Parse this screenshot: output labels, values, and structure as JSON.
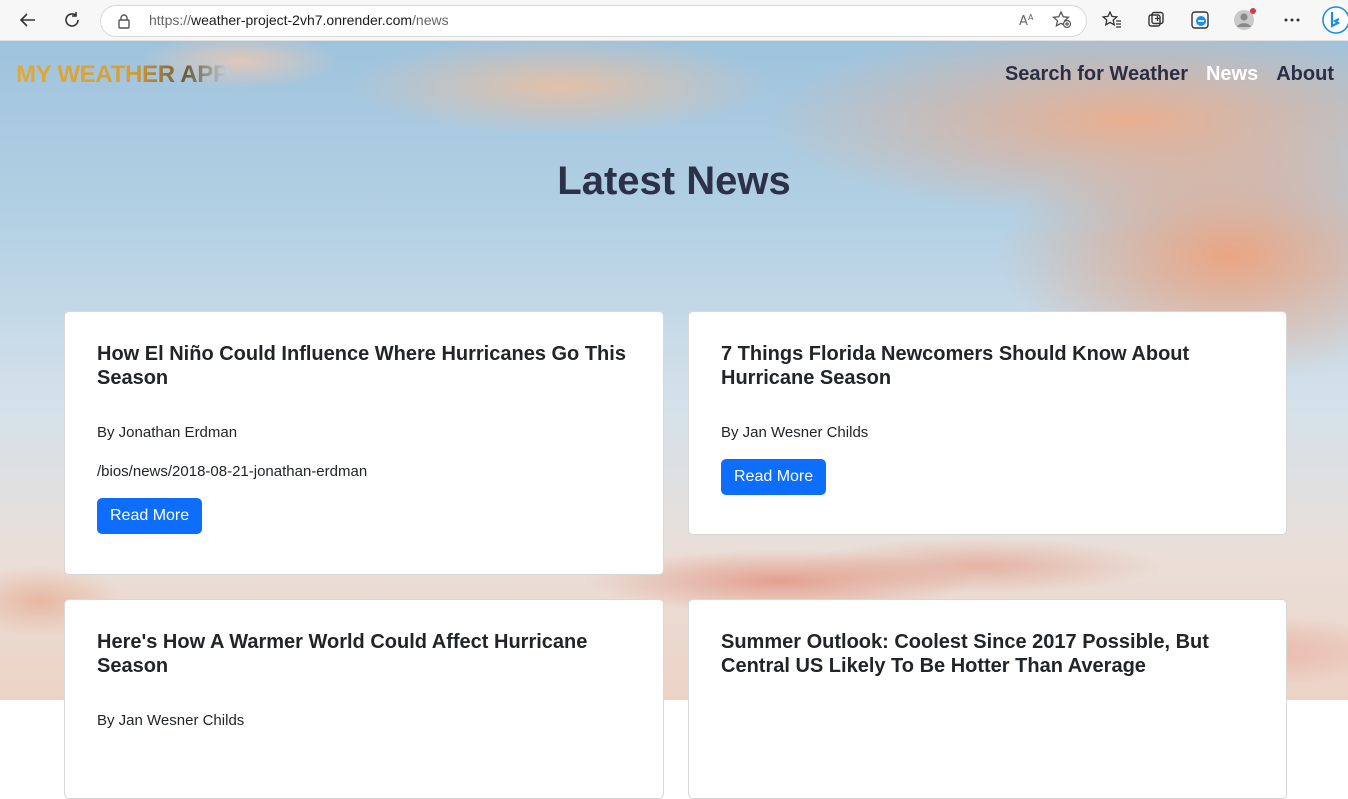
{
  "browser": {
    "url_prefix": "https://",
    "url_host": "weather-project-2vh7.onrender.com",
    "url_path": "/news"
  },
  "site": {
    "logo": "MY WEATHER APP",
    "nav": [
      "Search for Weather",
      "News",
      "About"
    ],
    "active_nav": "News"
  },
  "heading": "Latest News",
  "articles": [
    {
      "title": "How El Niño Could Influence Where Hurricanes Go This Season",
      "author": "By Jonathan Erdman",
      "link": "/bios/news/2018-08-21-jonathan-erdman",
      "button": "Read More"
    },
    {
      "title": "7 Things Florida Newcomers Should Know About Hurricane Season",
      "author": "By Jan Wesner Childs",
      "button": "Read More"
    },
    {
      "title": "Here's How A Warmer World Could Affect Hurricane Season",
      "author": "By Jan Wesner Childs"
    },
    {
      "title": "Summer Outlook: Coolest Since 2017 Possible, But Central US Likely To Be Hotter Than Average"
    }
  ],
  "colors": {
    "accent_button": "#0d6efd",
    "logo_gold": "#e3a834",
    "nav_text": "#2b2f45"
  }
}
